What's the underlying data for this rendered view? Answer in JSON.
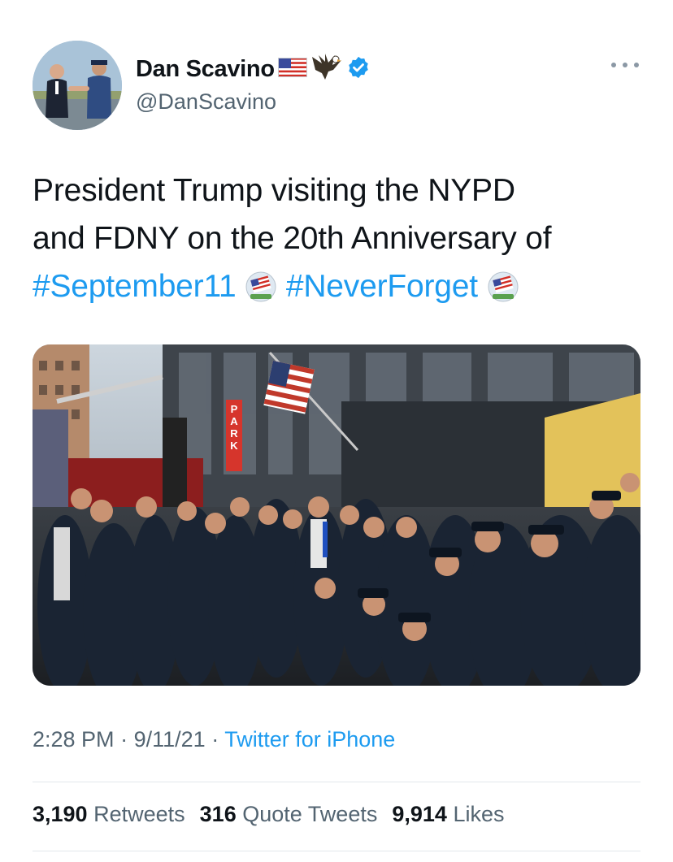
{
  "author": {
    "display_name": "Dan Scavino",
    "handle": "@DanScavino",
    "name_emojis": [
      "us-flag-icon",
      "eagle-icon"
    ],
    "verified": true,
    "verified_color": "#1d9bf0"
  },
  "tweet": {
    "text_line_1": "President Trump visiting the NYPD",
    "text_line_2": "and FDNY on the 20th Anniversary of",
    "hashtags": [
      "#September11",
      "#NeverForget"
    ],
    "hashtag_color": "#1d9bf0",
    "hashtag_emoji": "911-remembrance-flag-icon"
  },
  "media": {
    "type": "photo",
    "visible_sign_text": "PARK"
  },
  "meta": {
    "time": "2:28 PM",
    "separator": "·",
    "date": "9/11/21",
    "source": "Twitter for iPhone"
  },
  "stats": {
    "retweets_count": "3,190",
    "retweets_label": "Retweets",
    "quotes_count": "316",
    "quotes_label": "Quote Tweets",
    "likes_count": "9,914",
    "likes_label": "Likes"
  }
}
